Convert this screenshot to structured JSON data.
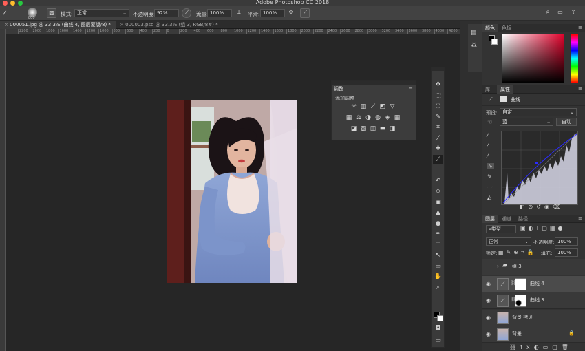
{
  "window": {
    "title": "Adobe Photoshop CC 2018",
    "traffic_colors": [
      "#ff5f57",
      "#febc2e",
      "#28c840"
    ]
  },
  "options": {
    "brush_size": "800",
    "mode_label": "模式:",
    "mode_value": "正常",
    "opacity_label": "不透明度:",
    "opacity_value": "92%",
    "flow_label": "流量:",
    "flow_value": "100%",
    "smooth_label": "平滑:",
    "smooth_value": "100%"
  },
  "tabs": [
    {
      "label": "000051.jpg @ 33.3% (曲线 4, 图层蒙版/8) *",
      "active": true
    },
    {
      "label": "000003.psd @ 33.3% (组 3, RGB/8#) *",
      "active": false
    }
  ],
  "ruler": {
    "ticks": [
      "2200",
      "2000",
      "1800",
      "1600",
      "1400",
      "1200",
      "1000",
      "800",
      "600",
      "400",
      "200",
      "0",
      "200",
      "400",
      "600",
      "800",
      "1000",
      "1200",
      "1400",
      "1600",
      "1800",
      "2000",
      "2200",
      "2400",
      "2600",
      "2800",
      "3000",
      "3200",
      "3400",
      "3600",
      "3800",
      "4000",
      "4200",
      "4400",
      "4600"
    ]
  },
  "adjustments_panel": {
    "title": "调整",
    "subtitle": "添加调整",
    "icons": [
      "brightness-icon",
      "levels-icon",
      "curves-icon",
      "exposure-icon",
      "vibrance-icon",
      "hue-sat-icon",
      "color-balance-icon",
      "bw-icon",
      "photo-filter-icon",
      "channel-mixer-icon",
      "color-lookup-icon",
      "invert-icon",
      "posterize-icon",
      "threshold-icon",
      "gradient-map-icon",
      "selective-color-icon"
    ]
  },
  "toolbar": {
    "tools": [
      "move-tool-icon",
      "marquee-tool-icon",
      "lasso-tool-icon",
      "quick-select-tool-icon",
      "crop-tool-icon",
      "eyedropper-tool-icon",
      "healing-tool-icon",
      "brush-tool-icon",
      "stamp-tool-icon",
      "history-brush-tool-icon",
      "eraser-tool-icon",
      "gradient-tool-icon",
      "blur-tool-icon",
      "dodge-tool-icon",
      "pen-tool-icon",
      "type-tool-icon",
      "path-select-tool-icon",
      "shape-tool-icon",
      "hand-tool-icon",
      "zoom-tool-icon",
      "more-tools-icon"
    ],
    "type_glyph": "T"
  },
  "color_panel": {
    "tabs": [
      "颜色",
      "色板"
    ]
  },
  "properties_panel": {
    "tabs": [
      "库",
      "属性"
    ],
    "adjustment_name": "曲线",
    "preset_label": "预设:",
    "preset_value": "自定",
    "channel_value": "蓝",
    "auto_label": "自动"
  },
  "layers_panel": {
    "tabs": [
      "图层",
      "通道",
      "路径"
    ],
    "filter_label": "类型",
    "blend_mode": "正常",
    "opacity_label": "不透明度:",
    "opacity_value": "100%",
    "lock_label": "锁定:",
    "fill_label": "填充:",
    "fill_value": "100%",
    "layers": [
      {
        "name": "组 3",
        "type": "group",
        "visible": false,
        "selected": false
      },
      {
        "name": "曲线 4",
        "type": "adjustment",
        "visible": true,
        "selected": true
      },
      {
        "name": "曲线 3",
        "type": "adjustment",
        "visible": true,
        "selected": false
      },
      {
        "name": "背景 拷贝",
        "type": "image",
        "visible": true,
        "selected": false
      },
      {
        "name": "背景",
        "type": "image",
        "visible": true,
        "selected": false
      }
    ]
  }
}
